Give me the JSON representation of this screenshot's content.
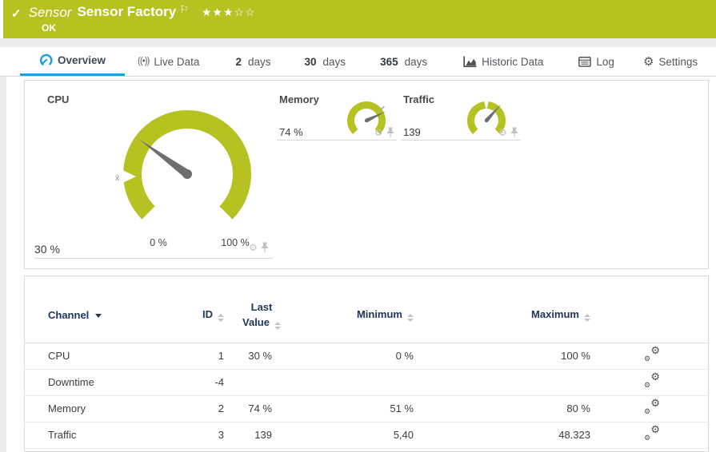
{
  "colors": {
    "status_green": "#b6c222",
    "accent_blue": "#1d9fd9",
    "table_header_navy": "#20355e"
  },
  "icons": {
    "check": "✓",
    "flag": "⚐",
    "stars_filled": "★★★",
    "stars_empty": "☆☆",
    "gear": "⚙",
    "live": "((•))"
  },
  "header": {
    "kind": "Sensor",
    "title": "Sensor Factory",
    "status": "OK",
    "rating_filled": 3,
    "rating_total": 5
  },
  "tabs": {
    "overview": {
      "label": "Overview"
    },
    "live_data": {
      "label": "Live Data"
    },
    "d2": {
      "num": "2",
      "unit": "days"
    },
    "d30": {
      "num": "30",
      "unit": "days"
    },
    "d365": {
      "num": "365",
      "unit": "days"
    },
    "historic": {
      "label": "Historic Data"
    },
    "log": {
      "label": "Log"
    },
    "settings": {
      "label": "Settings"
    }
  },
  "gauges": {
    "cpu": {
      "name": "CPU",
      "value": "30 %",
      "percent": 30,
      "min_label": "0 %",
      "max_label": "100 %",
      "avg_marker": "x̄"
    },
    "memory": {
      "name": "Memory",
      "value": "74 %",
      "percent": 74
    },
    "traffic": {
      "name": "Traffic",
      "value": "139",
      "percent": 67
    }
  },
  "table": {
    "headers": {
      "channel": "Channel",
      "id": "ID",
      "last_line1": "Last",
      "last_line2": "Value",
      "minimum": "Minimum",
      "maximum": "Maximum"
    },
    "rows": [
      {
        "channel": "CPU",
        "id": "1",
        "last": "30 %",
        "min": "0 %",
        "max": "100 %"
      },
      {
        "channel": "Downtime",
        "id": "-4",
        "last": "",
        "min": "",
        "max": ""
      },
      {
        "channel": "Memory",
        "id": "2",
        "last": "74 %",
        "min": "51 %",
        "max": "80 %"
      },
      {
        "channel": "Traffic",
        "id": "3",
        "last": "139",
        "min": "5,40",
        "max": "48.323"
      }
    ]
  }
}
